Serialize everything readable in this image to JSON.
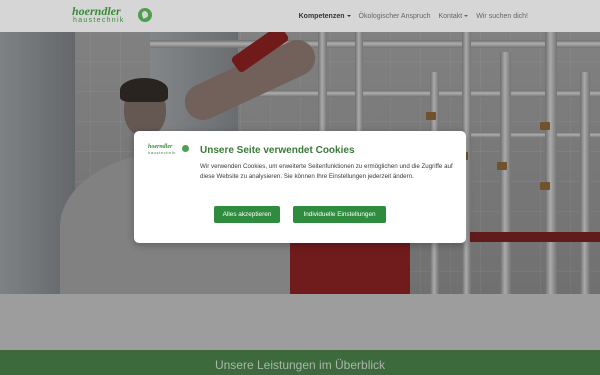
{
  "header": {
    "logo_brand": "hoerndler",
    "logo_sub": "haustechnik",
    "nav": [
      {
        "label": "Kompetenzen",
        "has_dropdown": true,
        "active": true
      },
      {
        "label": "Ökologischer Anspruch",
        "has_dropdown": false,
        "active": false
      },
      {
        "label": "Kontakt",
        "has_dropdown": true,
        "active": false
      },
      {
        "label": "Wir suchen dich!",
        "has_dropdown": false,
        "active": false
      }
    ]
  },
  "hero": {
    "image_icon": "plumber-at-pipes-photo"
  },
  "section": {
    "title": "Unsere Leistungen im Überblick"
  },
  "cookie_modal": {
    "logo_brand": "hoerndler",
    "logo_sub": "haustechnik",
    "title": "Unsere Seite verwendet Cookies",
    "text": "Wir verwenden Cookies, um erweiterte Seitenfunktionen zu ermöglichen und die Zugriffe auf diese Website zu analysieren. Sie können Ihre Einstellungen jederzeit ändern.",
    "accept_label": "Alles akzeptieren",
    "custom_label": "Individuelle Einstellungen"
  },
  "colors": {
    "brand_green": "#3a8a3a",
    "button_green": "#2f8c3e",
    "section_green": "#3c6a3c"
  }
}
